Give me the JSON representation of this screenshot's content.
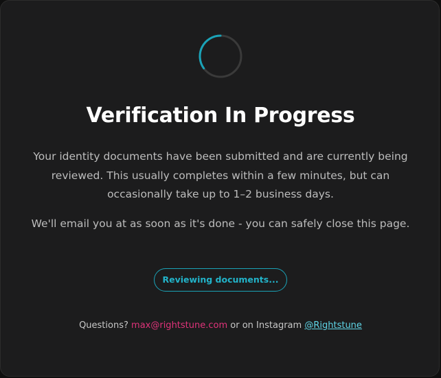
{
  "colors": {
    "background": "#1c1c1d",
    "accent": "#1aa3b8",
    "email_link": "#e0337a",
    "instagram_link": "#5fd6e8"
  },
  "spinner": {
    "icon": "loading-spinner-icon"
  },
  "title": "Verification In Progress",
  "body": {
    "paragraph_1": "Your identity documents have been submitted and are currently being reviewed. This usually completes within a few minutes, but can occasionally take up to 1–2 business days.",
    "paragraph_2": "We'll email you at as soon as it's done - you can safely close this page."
  },
  "status": {
    "label": "Reviewing documents..."
  },
  "footer": {
    "prefix": "Questions?",
    "email": "max@rightstune.com",
    "middle": "or on Instagram",
    "instagram": "@Rightstune"
  }
}
